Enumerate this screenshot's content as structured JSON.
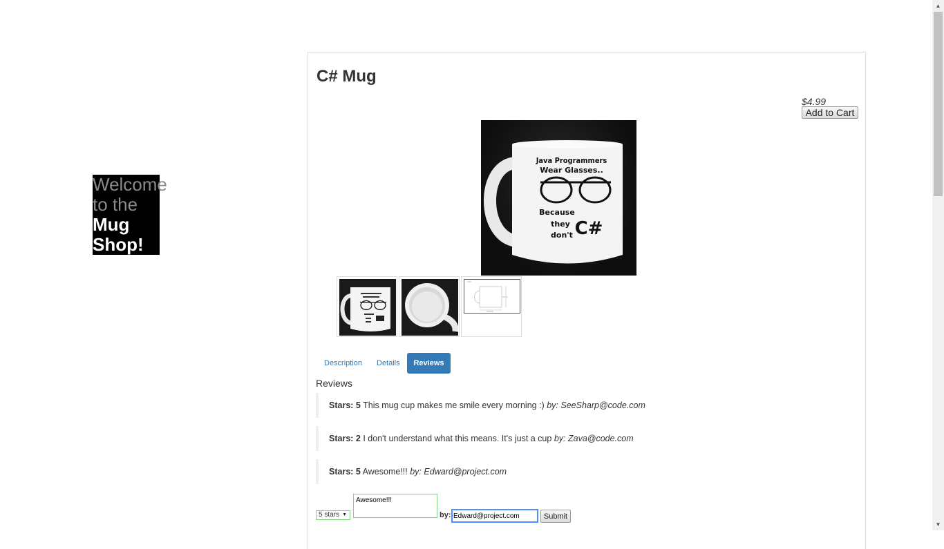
{
  "welcome": {
    "line1": "Welcome",
    "line2": "to the",
    "line3": "Mug",
    "line4": "Shop!"
  },
  "product": {
    "title": "C# Mug",
    "price": "$4.99",
    "add_to_cart_label": "Add to Cart",
    "mug_text": {
      "line1": "Java Programmers",
      "line2": "Wear Glasses..",
      "line3": "Because",
      "line4": "they",
      "line5": "don't",
      "line6": "C#"
    }
  },
  "tabs": [
    {
      "label": "Description",
      "active": false
    },
    {
      "label": "Details",
      "active": false
    },
    {
      "label": "Reviews",
      "active": true
    }
  ],
  "reviews": {
    "heading": "Reviews",
    "items": [
      {
        "stars_label": "Stars:",
        "stars": "5",
        "body": "This mug cup makes me smile every morning :)",
        "by_label": "by:",
        "author": "SeeSharp@code.com"
      },
      {
        "stars_label": "Stars:",
        "stars": "2",
        "body": "I don't understand what this means. It's just a cup",
        "by_label": "by:",
        "author": "Zava@code.com"
      },
      {
        "stars_label": "Stars:",
        "stars": "5",
        "body": "Awesome!!!",
        "by_label": "by:",
        "author": "Edward@project.com"
      }
    ]
  },
  "form": {
    "stars_selected": "5 stars",
    "comment_value": "Awesome!!!",
    "by_label": "by:",
    "author_value": "Edward@project.com",
    "submit_label": "Submit"
  },
  "colors": {
    "tab_active_bg": "#337ab7",
    "link": "#337ab7",
    "focus_border": "#4d90fe",
    "valid_border": "#7fd17f"
  }
}
